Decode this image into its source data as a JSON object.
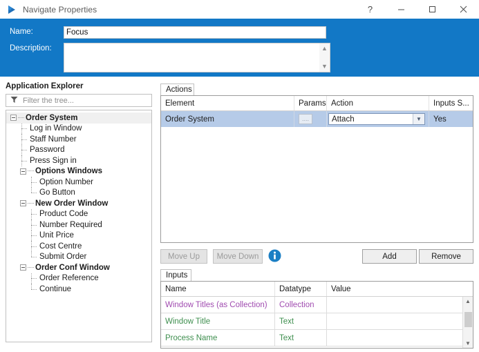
{
  "window": {
    "title": "Navigate Properties",
    "icon": "navigate-arrow-icon",
    "controls": {
      "help": "?",
      "minimize": "minimize-icon",
      "maximize": "maximize-icon",
      "close": "close-icon"
    },
    "header_color": "#1278c6"
  },
  "form": {
    "name_label": "Name:",
    "name_value": "Focus",
    "name_placeholder": "",
    "description_label": "Description:",
    "description_value": "",
    "description_placeholder": ""
  },
  "explorer": {
    "title": "Application Explorer",
    "filter_placeholder": "Filter the tree...",
    "filter_value": "",
    "tree": [
      {
        "label": "Order System",
        "level": 0,
        "bold": true,
        "expandable": true,
        "selected": true,
        "last": false
      },
      {
        "label": "Log in Window",
        "level": 1,
        "bold": false,
        "expandable": false,
        "selected": false,
        "last": false
      },
      {
        "label": "Staff Number",
        "level": 1,
        "bold": false,
        "expandable": false,
        "selected": false,
        "last": false
      },
      {
        "label": "Password",
        "level": 1,
        "bold": false,
        "expandable": false,
        "selected": false,
        "last": false
      },
      {
        "label": "Press Sign in",
        "level": 1,
        "bold": false,
        "expandable": false,
        "selected": false,
        "last": false
      },
      {
        "label": "Options Windows",
        "level": 1,
        "bold": true,
        "expandable": true,
        "selected": false,
        "last": false
      },
      {
        "label": "Option Number",
        "level": 2,
        "bold": false,
        "expandable": false,
        "selected": false,
        "last": false
      },
      {
        "label": "Go Button",
        "level": 2,
        "bold": false,
        "expandable": false,
        "selected": false,
        "last": true
      },
      {
        "label": "New Order Window",
        "level": 1,
        "bold": true,
        "expandable": true,
        "selected": false,
        "last": false
      },
      {
        "label": "Product Code",
        "level": 2,
        "bold": false,
        "expandable": false,
        "selected": false,
        "last": false
      },
      {
        "label": "Number Required",
        "level": 2,
        "bold": false,
        "expandable": false,
        "selected": false,
        "last": false
      },
      {
        "label": "Unit Price",
        "level": 2,
        "bold": false,
        "expandable": false,
        "selected": false,
        "last": false
      },
      {
        "label": "Cost Centre",
        "level": 2,
        "bold": false,
        "expandable": false,
        "selected": false,
        "last": false
      },
      {
        "label": "Submit Order",
        "level": 2,
        "bold": false,
        "expandable": false,
        "selected": false,
        "last": true
      },
      {
        "label": "Order Conf Window",
        "level": 1,
        "bold": true,
        "expandable": true,
        "selected": false,
        "last": false
      },
      {
        "label": "Order Reference",
        "level": 2,
        "bold": false,
        "expandable": false,
        "selected": false,
        "last": false
      },
      {
        "label": "Continue",
        "level": 2,
        "bold": false,
        "expandable": false,
        "selected": false,
        "last": true
      }
    ]
  },
  "actions_panel": {
    "tab_label": "Actions",
    "columns": [
      "Element",
      "Params",
      "Action",
      "Inputs S..."
    ],
    "rows": [
      {
        "element": "Order System",
        "params_button": "....",
        "action": "Attach",
        "inputs_supplied": "Yes",
        "selected": true
      }
    ]
  },
  "toolbar": {
    "move_up": "Move Up",
    "move_down": "Move Down",
    "move_up_enabled": false,
    "move_down_enabled": false,
    "info_icon": "info-icon",
    "add": "Add",
    "remove": "Remove"
  },
  "inputs_panel": {
    "tab_label": "Inputs",
    "columns": [
      "Name",
      "Datatype",
      "Value"
    ],
    "rows": [
      {
        "name": "Window Titles (as Collection)",
        "datatype": "Collection",
        "value": "",
        "color": "#a04bb0"
      },
      {
        "name": "Window Title",
        "datatype": "Text",
        "value": "",
        "color": "#3f8f4f"
      },
      {
        "name": "Process Name",
        "datatype": "Text",
        "value": "",
        "color": "#3f8f4f"
      }
    ]
  }
}
